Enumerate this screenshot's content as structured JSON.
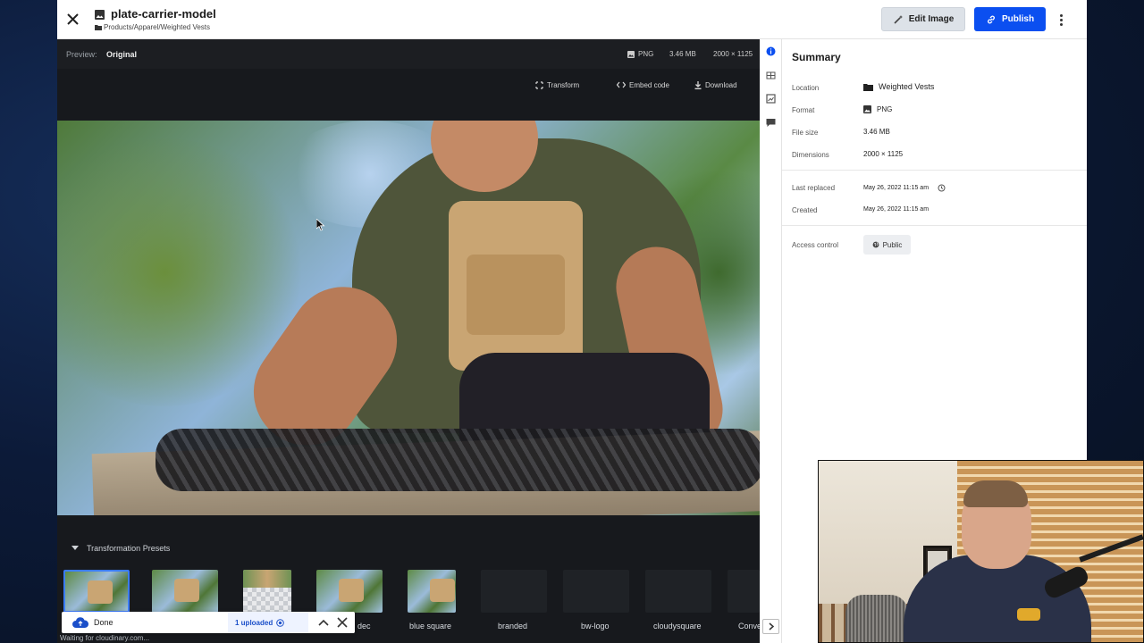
{
  "header": {
    "asset_title": "plate-carrier-model",
    "breadcrumb": "Products/Apparel/Weighted Vests",
    "edit_label": "Edit Image",
    "publish_label": "Publish"
  },
  "preview": {
    "label": "Preview:",
    "value": "Original",
    "format": "PNG",
    "size": "3.46 MB",
    "dimensions": "2000 × 1125",
    "actions": {
      "transform": "Transform",
      "embed": "Embed code",
      "download": "Download"
    }
  },
  "presets": {
    "title": "Transformation Presets",
    "items": [
      {
        "label": "",
        "kind": "photo"
      },
      {
        "label": "",
        "kind": "photo"
      },
      {
        "label": "",
        "kind": "checker"
      },
      {
        "label": "dec",
        "kind": "photo"
      },
      {
        "label": "blue square",
        "kind": "portrait"
      },
      {
        "label": "branded",
        "kind": "empty"
      },
      {
        "label": "bw-logo",
        "kind": "empty"
      },
      {
        "label": "cloudysquare",
        "kind": "empty"
      },
      {
        "label": "Conve",
        "kind": "empty"
      }
    ]
  },
  "upload_toast": {
    "status": "Done",
    "count": "1 uploaded"
  },
  "status_bar": "Waiting for cloudinary.com...",
  "summary": {
    "title": "Summary",
    "location_label": "Location",
    "location_value": "Weighted Vests",
    "format_label": "Format",
    "format_value": "PNG",
    "filesize_label": "File size",
    "filesize_value": "3.46 MB",
    "dimensions_label": "Dimensions",
    "dimensions_value": "2000 × 1125",
    "replaced_label": "Last replaced",
    "replaced_value": "May 26, 2022 11:15 am",
    "created_label": "Created",
    "created_value": "May 26, 2022 11:15 am",
    "access_label": "Access control",
    "access_value": "Public"
  },
  "colors": {
    "primary": "#0b4ff0",
    "preview_bg": "#17191d",
    "edit_bg": "#dde2e8"
  }
}
